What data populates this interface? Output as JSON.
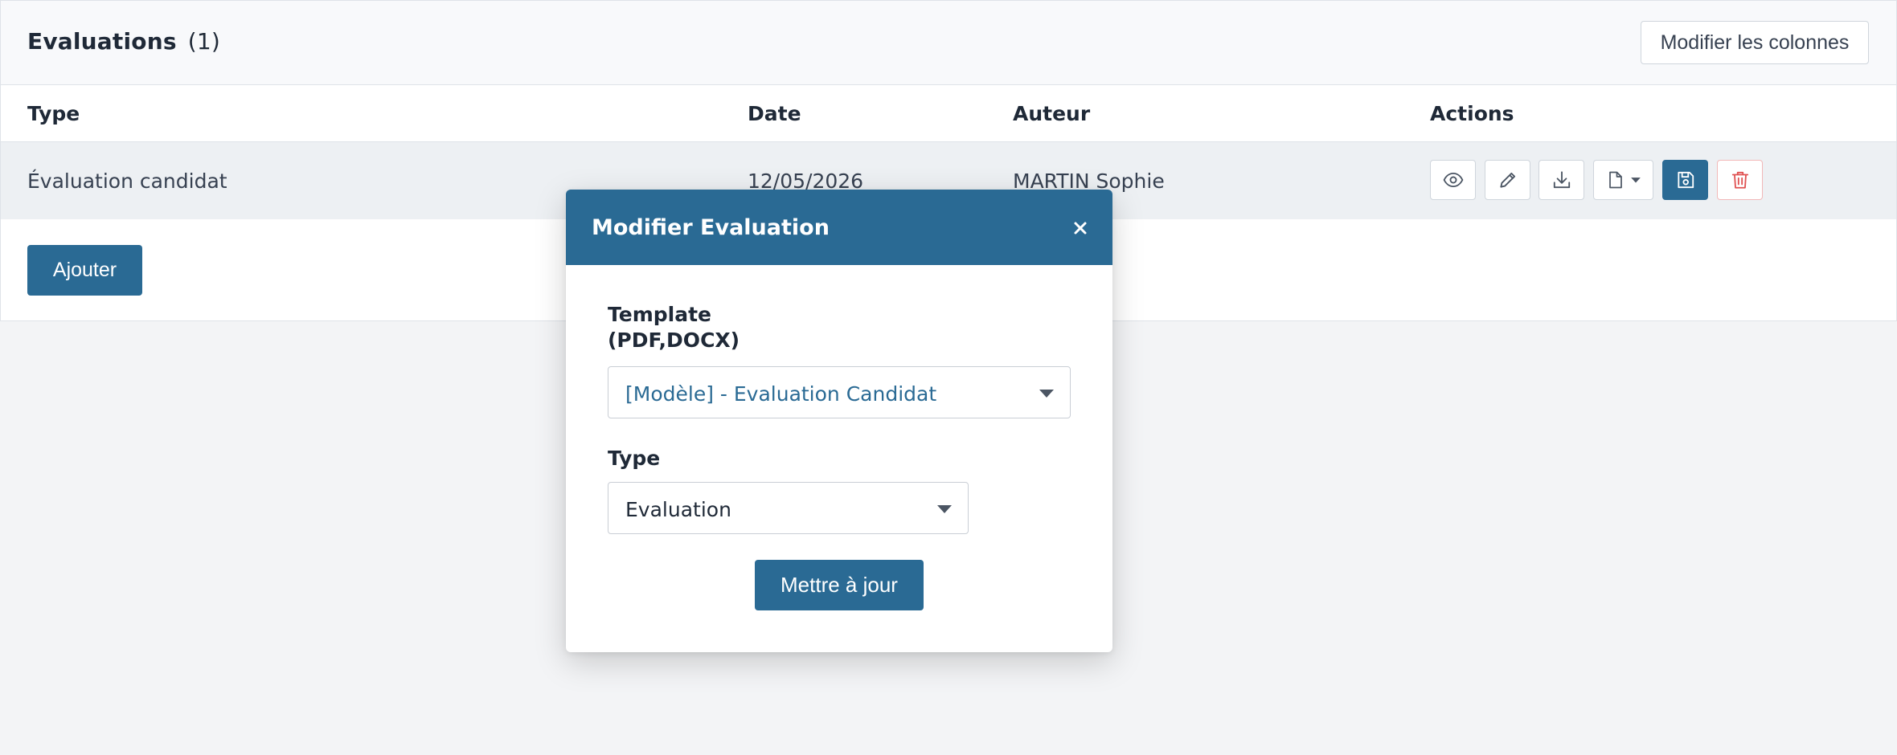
{
  "panel": {
    "title": "Evaluations",
    "count": "(1)",
    "columns_button": "Modifier les colonnes"
  },
  "table": {
    "headers": {
      "type": "Type",
      "date": "Date",
      "author": "Auteur",
      "actions": "Actions"
    },
    "rows": [
      {
        "type": "Évaluation candidat",
        "date": "12/05/2026",
        "author": "MARTIN Sophie"
      }
    ],
    "row_actions": [
      "eye-icon",
      "pencil-icon",
      "download-icon",
      "file-icon",
      "save-icon",
      "trash-icon"
    ]
  },
  "add_button": "Ajouter",
  "modal": {
    "title": "Modifier Evaluation",
    "close_label": "×",
    "template_label_line1": "Template",
    "template_label_line2": "(PDF,DOCX)",
    "template_value": "[Modèle] - Evaluation Candidat",
    "type_label": "Type",
    "type_value": "Evaluation",
    "update_button": "Mettre à jour"
  },
  "colors": {
    "primary": "#2a6a94",
    "danger": "#e05252",
    "link_text": "#2a6a94"
  }
}
